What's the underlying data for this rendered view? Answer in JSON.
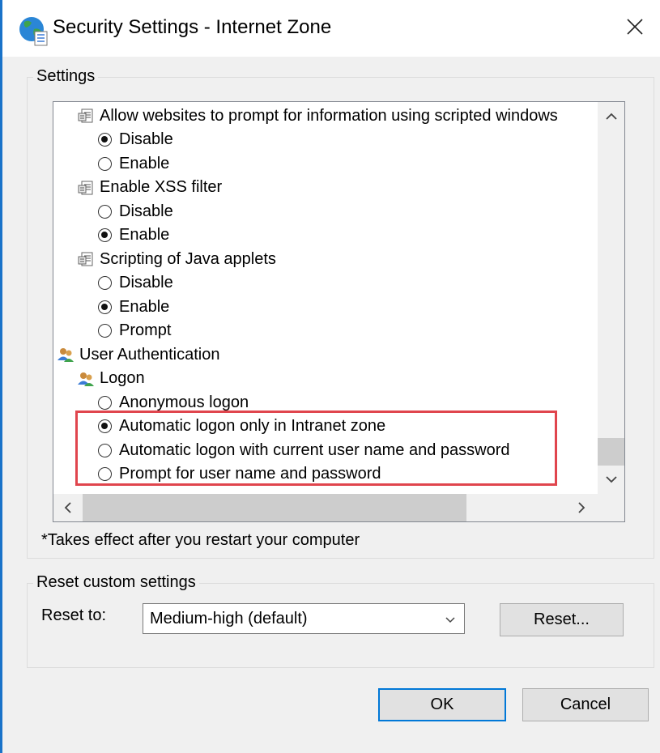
{
  "window": {
    "title": "Security Settings - Internet Zone"
  },
  "settings_group": {
    "label": "Settings",
    "tree": [
      {
        "kind": "setting",
        "icon": "script-setting-icon",
        "label": "Allow websites to prompt for information using scripted windows"
      },
      {
        "kind": "option",
        "label": "Disable",
        "selected": true
      },
      {
        "kind": "option",
        "label": "Enable",
        "selected": false
      },
      {
        "kind": "setting",
        "icon": "script-setting-icon",
        "label": "Enable XSS filter"
      },
      {
        "kind": "option",
        "label": "Disable",
        "selected": false
      },
      {
        "kind": "option",
        "label": "Enable",
        "selected": true
      },
      {
        "kind": "setting",
        "icon": "script-setting-icon",
        "label": "Scripting of Java applets"
      },
      {
        "kind": "option",
        "label": "Disable",
        "selected": false
      },
      {
        "kind": "option",
        "label": "Enable",
        "selected": true
      },
      {
        "kind": "option",
        "label": "Prompt",
        "selected": false
      },
      {
        "kind": "category",
        "icon": "users-icon",
        "label": "User Authentication"
      },
      {
        "kind": "setting",
        "icon": "users-icon",
        "label": "Logon"
      },
      {
        "kind": "option",
        "label": "Anonymous logon",
        "selected": false
      },
      {
        "kind": "option",
        "label": "Automatic logon only in Intranet zone",
        "selected": true
      },
      {
        "kind": "option",
        "label": "Automatic logon with current user name and password",
        "selected": false
      },
      {
        "kind": "option",
        "label": "Prompt for user name and password",
        "selected": false
      }
    ],
    "note": "*Takes effect after you restart your computer"
  },
  "reset_group": {
    "label": "Reset custom settings",
    "reset_to_label": "Reset to:",
    "level_value": "Medium-high (default)",
    "reset_button": "Reset..."
  },
  "buttons": {
    "ok": "OK",
    "cancel": "Cancel"
  },
  "colors": {
    "highlight_border": "#e0454d",
    "accent": "#0078d7",
    "window_border": "#1a73c9"
  }
}
